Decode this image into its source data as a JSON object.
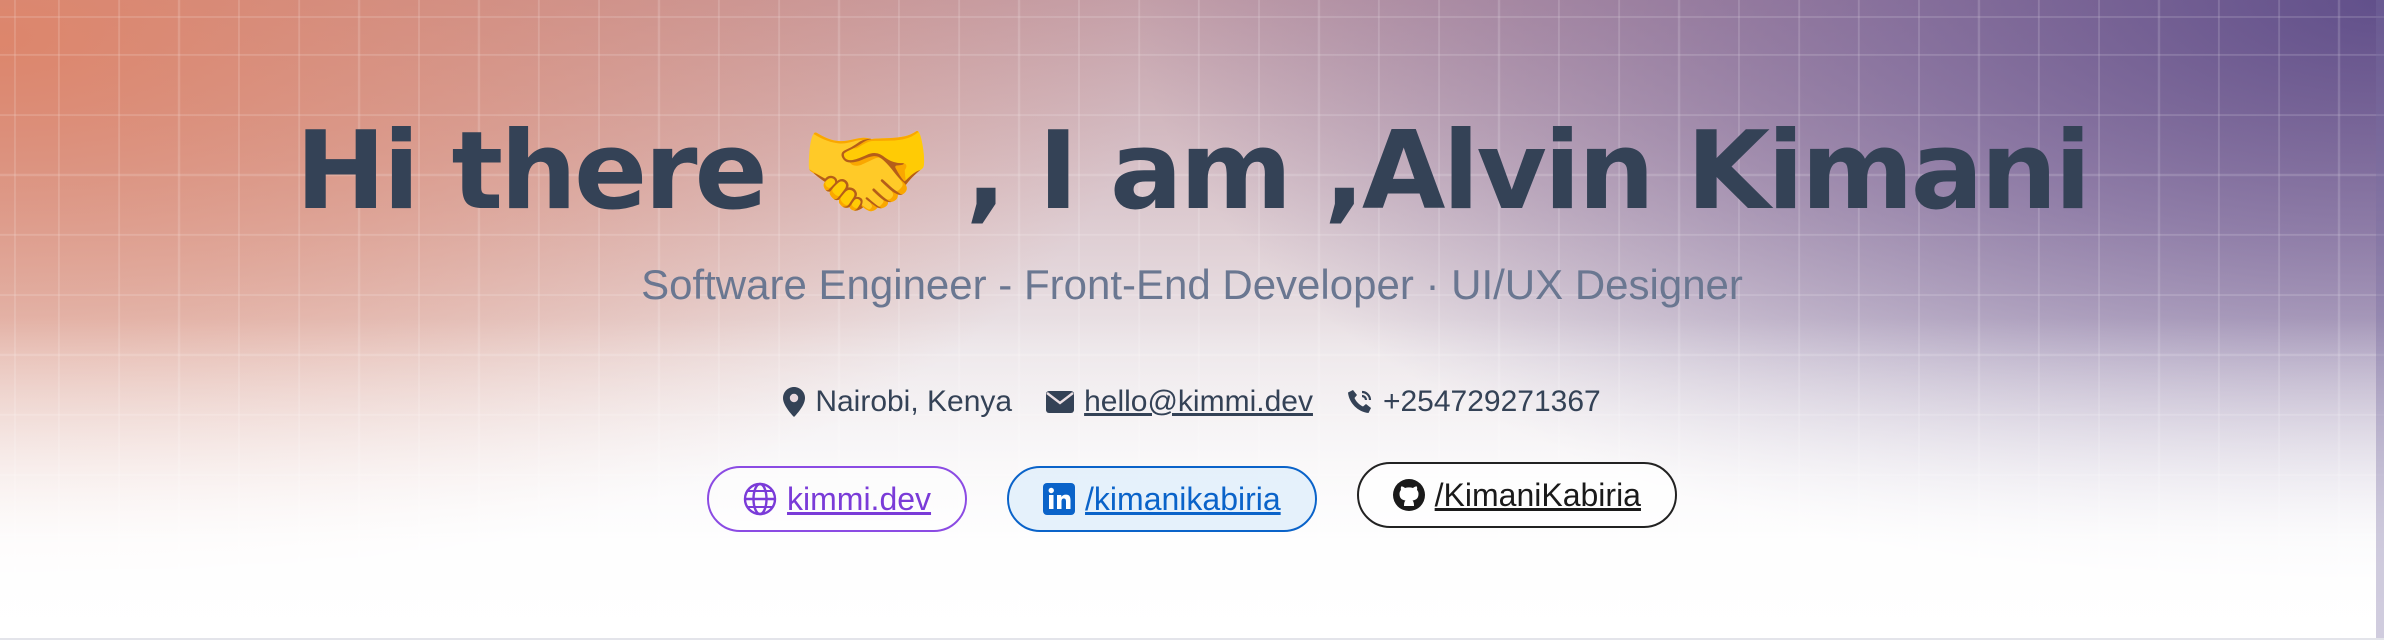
{
  "hero": {
    "title": "Hi there 🤝 , I am ,Alvin Kimani",
    "subtitle": "Software Engineer - Front-End Developer · UI/UX Designer"
  },
  "contacts": {
    "location": "Nairobi, Kenya",
    "email": "hello@kimmi.dev",
    "phone": "+254729271367"
  },
  "links": {
    "website": "kimmi.dev",
    "linkedin": "/kimanikabiria",
    "github": "/KimaniKabiria"
  },
  "colors": {
    "text_dark": "#344256",
    "subtitle": "#6a7791",
    "website_accent": "#7a3bd8",
    "linkedin_accent": "#0a63c9",
    "github_accent": "#1a1a1a"
  },
  "icons": {
    "location": "map-pin-icon",
    "email": "envelope-icon",
    "phone": "phone-icon",
    "website": "globe-icon",
    "linkedin": "linkedin-icon",
    "github": "github-icon"
  }
}
